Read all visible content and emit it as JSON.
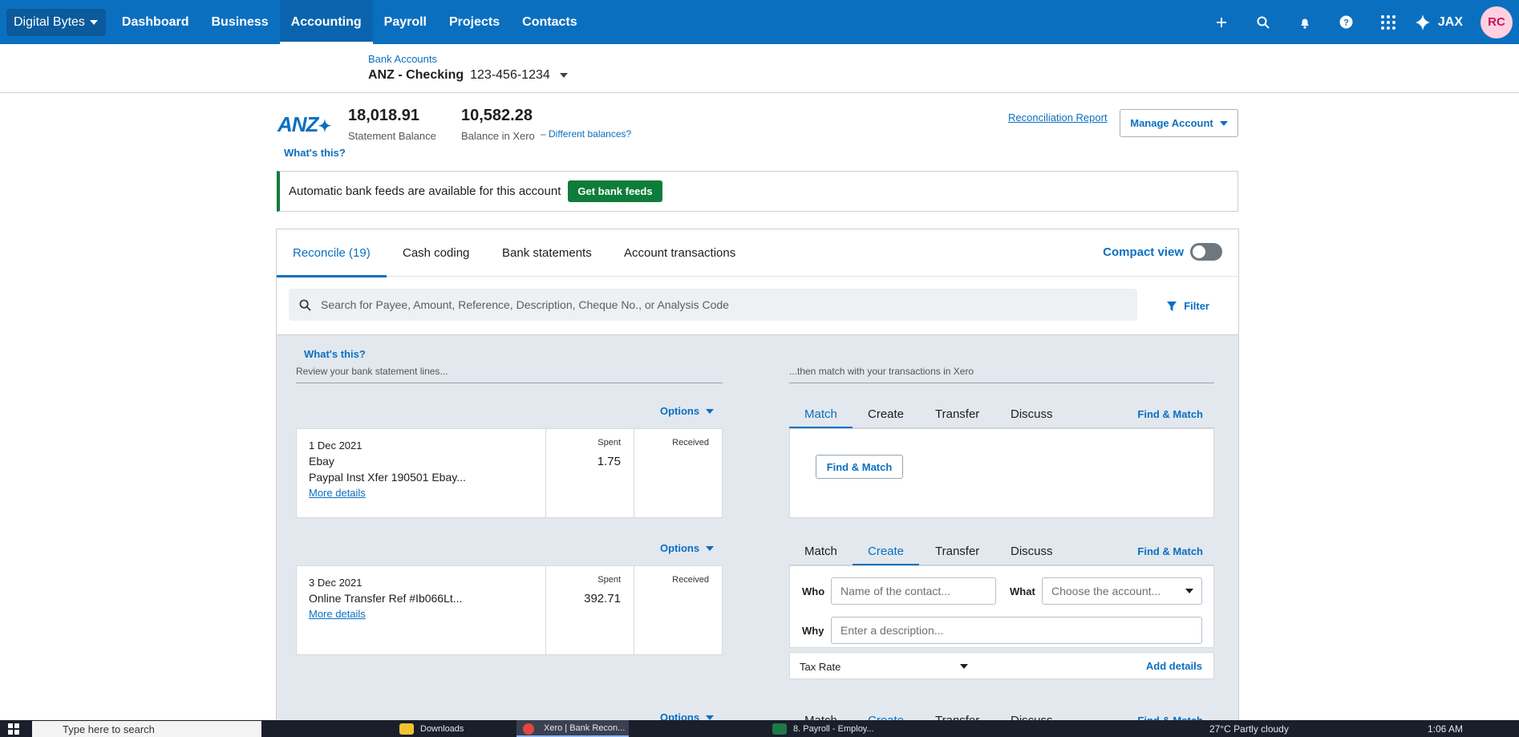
{
  "topnav": {
    "org": "Digital Bytes",
    "items": [
      "Dashboard",
      "Business",
      "Accounting",
      "Payroll",
      "Projects",
      "Contacts"
    ],
    "active": "Accounting",
    "jax": "JAX",
    "avatar": "RC"
  },
  "account": {
    "breadcrumb": "Bank Accounts",
    "name": "ANZ - Checking",
    "number": "123-456-1234"
  },
  "balances": {
    "logo": "ANZ",
    "statement_amount": "18,018.91",
    "statement_label": "Statement Balance",
    "xero_amount": "10,582.28",
    "xero_label": "Balance in Xero",
    "different_link": "– Different balances?",
    "whats_this": "What's this?",
    "recon_report": "Reconciliation Report",
    "manage_account": "Manage Account"
  },
  "feed_banner": {
    "text": "Automatic bank feeds are available for this account",
    "button": "Get bank feeds"
  },
  "tabs": {
    "items": [
      "Reconcile (19)",
      "Cash coding",
      "Bank statements",
      "Account transactions"
    ],
    "active": "Reconcile (19)",
    "compact_view": "Compact view"
  },
  "search": {
    "placeholder": "Search for Payee, Amount, Reference, Description, Cheque No., or Analysis Code",
    "filter": "Filter"
  },
  "reconcile": {
    "whats_this": "What's this?",
    "left_header": "Review your bank statement lines...",
    "right_header": "...then match with your transactions in Xero",
    "options_label": "Options",
    "spent_label": "Spent",
    "received_label": "Received",
    "more_details": "More details",
    "match_tabs": [
      "Match",
      "Create",
      "Transfer",
      "Discuss"
    ],
    "find_match": "Find & Match",
    "lines": [
      {
        "date": "1 Dec 2021",
        "payee": "Ebay",
        "reference": "Paypal Inst Xfer 190501 Ebay...",
        "spent": "1.75",
        "received": "",
        "active_tab": "Match",
        "find_match_button": "Find & Match"
      },
      {
        "date": "3 Dec 2021",
        "payee": "",
        "reference": "Online Transfer Ref #Ib066Lt...",
        "spent": "392.71",
        "received": "",
        "active_tab": "Create",
        "create_form": {
          "who_label": "Who",
          "who_placeholder": "Name of the contact...",
          "what_label": "What",
          "what_placeholder": "Choose the account...",
          "why_label": "Why",
          "why_placeholder": "Enter a description...",
          "tax_rate": "Tax Rate",
          "add_details": "Add details"
        }
      }
    ],
    "third_line_tabs": [
      "Match",
      "Create",
      "Transfer",
      "Discuss"
    ],
    "third_line_active": "Create"
  },
  "taskbar": {
    "search_placeholder": "Type here to search",
    "apps": [
      "Downloads",
      "Xero | Bank Recon...",
      "8. Payroll - Employ..."
    ],
    "weather": "27°C  Partly cloudy",
    "time": "1:06 AM"
  }
}
